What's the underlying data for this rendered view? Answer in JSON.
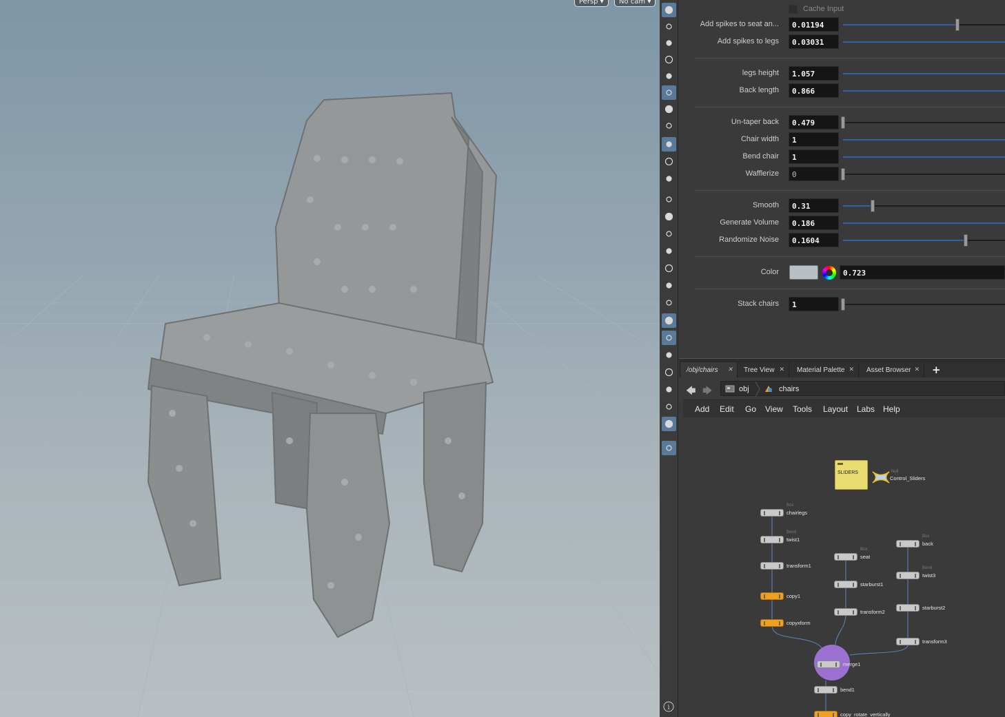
{
  "viewport": {
    "camera_menu": "Persp",
    "cam_menu": "No cam"
  },
  "params": {
    "cache_input_label": "Cache Input",
    "rows": [
      {
        "label": "Add spikes to seat an...",
        "value": "0.01194",
        "fraction": 0.69
      },
      {
        "label": "Add spikes to legs",
        "value": "0.03031",
        "fraction": 1.0
      },
      {
        "label": "legs height",
        "value": "1.057",
        "fraction": 1.0
      },
      {
        "label": "Back length",
        "value": "0.866",
        "fraction": 1.0
      },
      {
        "label": "Un-taper back",
        "value": "0.479",
        "fraction": 0.0
      },
      {
        "label": "Chair width",
        "value": "1",
        "fraction": 1.0
      },
      {
        "label": "Bend chair",
        "value": "1",
        "fraction": 1.0
      },
      {
        "label": "Wafflerize",
        "value": "0",
        "fraction": 0.0
      },
      {
        "label": "Smooth",
        "value": "0.31",
        "fraction": 0.18
      },
      {
        "label": "Generate Volume",
        "value": "0.186",
        "fraction": 1.0
      },
      {
        "label": "Randomize Noise",
        "value": "0.1604",
        "fraction": 0.74
      },
      {
        "label": "Stack chairs",
        "value": "1",
        "fraction": 0.0
      }
    ],
    "color": {
      "label": "Color",
      "value": "0.723",
      "swatch": "#b8c0c6"
    }
  },
  "network": {
    "tabs": [
      {
        "label": "/obj/chairs"
      },
      {
        "label": "Tree View"
      },
      {
        "label": "Material Palette"
      },
      {
        "label": "Asset Browser"
      }
    ],
    "tab_add": "+",
    "path": {
      "root": "obj",
      "current": "chairs"
    },
    "menu": [
      "Add",
      "Edit",
      "Go",
      "View",
      "Tools",
      "Layout",
      "Labs",
      "Help"
    ],
    "sticky_text": "SLIDERS",
    "null_node": {
      "type": "Null",
      "label": "Control_Sliders"
    },
    "nodes": [
      {
        "name": "chairlegs",
        "type": "Box",
        "kind": "gray"
      },
      {
        "name": "twist1",
        "type": "Bend",
        "kind": "gray"
      },
      {
        "name": "transform1",
        "type": "",
        "kind": "gray"
      },
      {
        "name": "copy1",
        "type": "",
        "kind": "orange"
      },
      {
        "name": "copyxform",
        "type": "",
        "kind": "orange"
      },
      {
        "name": "seat",
        "type": "Box",
        "kind": "gray"
      },
      {
        "name": "starburst1",
        "type": "",
        "kind": "gray"
      },
      {
        "name": "transform2",
        "type": "",
        "kind": "gray"
      },
      {
        "name": "back",
        "type": "Box",
        "kind": "gray"
      },
      {
        "name": "twist3",
        "type": "Bend",
        "kind": "gray"
      },
      {
        "name": "starburst2",
        "type": "",
        "kind": "gray"
      },
      {
        "name": "transform3",
        "type": "",
        "kind": "gray"
      },
      {
        "name": "merge1",
        "type": "",
        "kind": "gray"
      },
      {
        "name": "bend1",
        "type": "",
        "kind": "gray"
      },
      {
        "name": "copy_rotate_vertically",
        "type": "",
        "kind": "orange"
      }
    ]
  },
  "toolbar": {
    "icons": [
      "display-options-icon",
      "snapshot-icon",
      "lock-icon",
      "ghost-icon",
      "shading-icon",
      "lighting-icon",
      "light-bulb-icon",
      "skull-icon",
      "render-view-icon",
      "visualize-icon",
      "camera-icon",
      "point-icon",
      "brush-icon",
      "pin-icon",
      "point-numbers-icon",
      "fill-icon",
      "prim-numbers-icon",
      "normals-icon",
      "wireframe-icon",
      "checker-icon",
      "geometry-icon",
      "uv-icon",
      "handle-icon",
      "background-icon",
      "image-icon",
      "pin-location-icon",
      "info-icon"
    ]
  }
}
